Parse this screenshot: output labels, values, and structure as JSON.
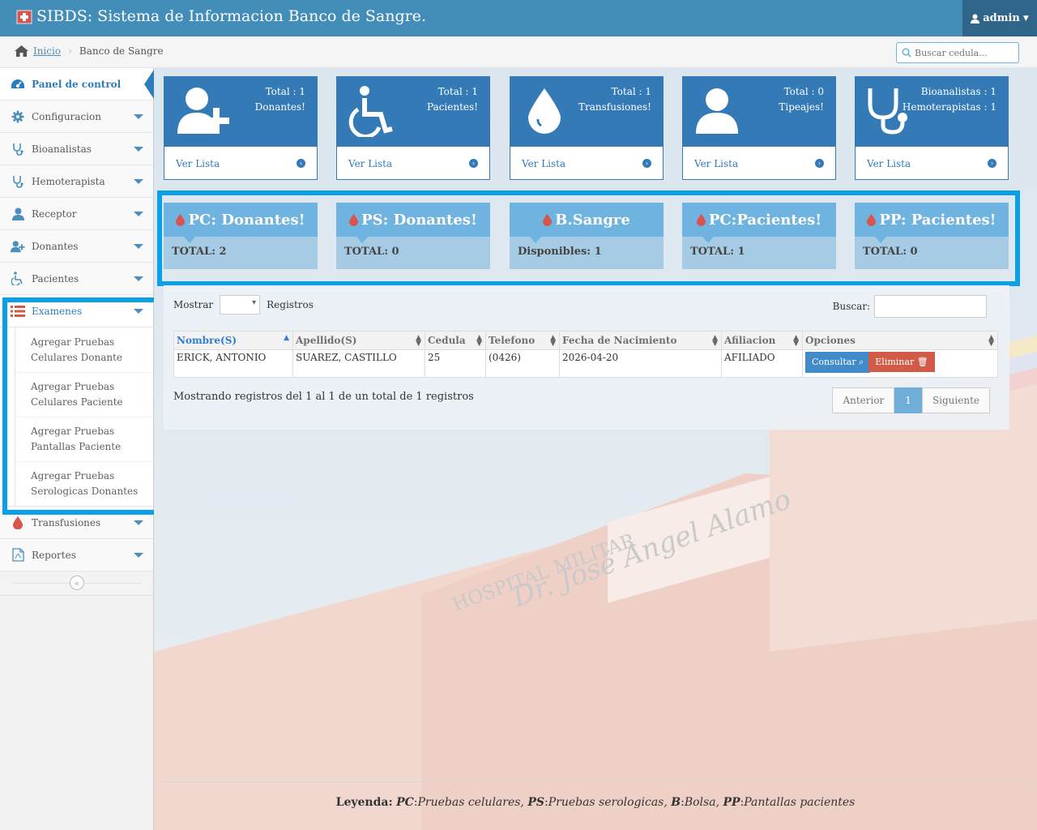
{
  "app": {
    "title": "SIBDS: Sistema de Informacion Banco de Sangre.",
    "user": "admin"
  },
  "breadcrumb": {
    "home": "Inicio",
    "current": "Banco de Sangre"
  },
  "search": {
    "placeholder": "Buscar cedula..."
  },
  "sidebar": {
    "items": [
      {
        "label": "Panel de control",
        "icon": "dashboard-icon"
      },
      {
        "label": "Configuracion",
        "icon": "gear-icon"
      },
      {
        "label": "Bioanalistas",
        "icon": "stethoscope-icon"
      },
      {
        "label": "Hemoterapista",
        "icon": "stethoscope-icon"
      },
      {
        "label": "Receptor",
        "icon": "user-icon"
      },
      {
        "label": "Donantes",
        "icon": "user-plus-icon"
      },
      {
        "label": "Pacientes",
        "icon": "wheelchair-icon"
      },
      {
        "label": "Examenes",
        "icon": "list-icon"
      },
      {
        "label": "Transfusiones",
        "icon": "drop-icon"
      },
      {
        "label": "Reportes",
        "icon": "pdf-icon"
      }
    ],
    "submenu": [
      "Agregar Pruebas Celulares Donante",
      "Agregar Pruebas Celulares Paciente",
      "Agregar Pruebas Pantallas Paciente",
      "Agregar Pruebas Serologicas Donantes"
    ]
  },
  "stats": [
    {
      "line1": "Total : 1",
      "line2": "Donantes!",
      "footer": "Ver Lista",
      "icon": "user-plus-icon"
    },
    {
      "line1": "Total : 1",
      "line2": "Pacientes!",
      "footer": "Ver Lista",
      "icon": "wheelchair-icon"
    },
    {
      "line1": "Total : 1",
      "line2": "Transfusiones!",
      "footer": "Ver Lista",
      "icon": "drop-icon"
    },
    {
      "line1": "Total : 0",
      "line2": "Tipeajes!",
      "footer": "Ver Lista",
      "icon": "user-icon"
    },
    {
      "line1": "Bioanalistas : 1",
      "line2": "Hemoterapistas : 1",
      "footer": "Ver Lista",
      "icon": "stethoscope-icon"
    }
  ],
  "infoBoxes": [
    {
      "title": "PC: Donantes!",
      "value": "TOTAL: 2"
    },
    {
      "title": "PS: Donantes!",
      "value": "TOTAL: 0"
    },
    {
      "title": "B.Sangre",
      "value": "Disponibles: 1"
    },
    {
      "title": "PC:Pacientes!",
      "value": "TOTAL: 1"
    },
    {
      "title": "PP: Pacientes!",
      "value": "TOTAL: 0"
    }
  ],
  "table": {
    "show_label": "Mostrar",
    "records_label": "Registros",
    "search_label": "Buscar:",
    "columns": [
      "Nombre(S)",
      "Apellido(S)",
      "Cedula",
      "Telefono",
      "Fecha de Nacimiento",
      "Afiliacion",
      "Opciones"
    ],
    "rows": [
      {
        "nombre": "ERICK, ANTONIO",
        "apellido": "SUAREZ, CASTILLO",
        "cedula": "25",
        "telefono": "(0426)",
        "fecha": "2026-04-20",
        "afiliacion": "AFILIADO"
      }
    ],
    "btn_consultar": "Consultar",
    "btn_eliminar": "Eliminar",
    "info": "Mostrando registros del 1 al 1 de un total de 1 registros",
    "pager": {
      "prev": "Anterior",
      "page": "1",
      "next": "Siguiente"
    }
  },
  "legend": {
    "label": "Leyenda:",
    "items": [
      {
        "key": "PC",
        "desc": "Pruebas celulares,"
      },
      {
        "key": "PS",
        "desc": "Pruebas serologicas,"
      },
      {
        "key": "B",
        "desc": "Bolsa,"
      },
      {
        "key": "PP",
        "desc": "Pantallas pacientes"
      }
    ]
  },
  "background": {
    "sign_line1": "HOSPITAL MILITAR",
    "sign_line2": "Dr. José Angel Alamo"
  },
  "colors": {
    "primary": "#337ab7",
    "navbar": "#438eb9",
    "highlight": "#0aa0e8",
    "info": "#6fb3e0",
    "danger": "#d15b47"
  }
}
